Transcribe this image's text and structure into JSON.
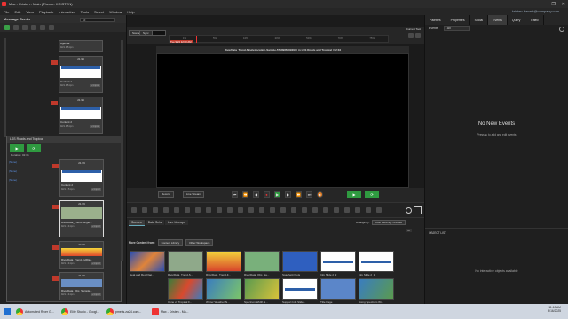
{
  "window": {
    "title": "Max - Kristen - Main (Theme: KRISTEN)",
    "controls": [
      "—",
      "❐",
      "✕"
    ]
  },
  "menu": {
    "items": [
      "File",
      "Edit",
      "View",
      "Playback",
      "Interactive",
      "Tools",
      "Select",
      "Window",
      "Help"
    ],
    "user": "kristen.barrett@company.com"
  },
  "message_center": {
    "title": "Message Center",
    "filter": "All",
    "items": [
      {
        "name": "Agenda",
        "meta": "9/21 4:51pm",
        "badge": ""
      },
      {
        "name": "Content 1",
        "meta": "9/21 4:51pm",
        "badge": "21.99",
        "btn": "+ Import"
      },
      {
        "name": "Content 2",
        "meta": "9/21 4:51pm",
        "badge": "21.99",
        "btn": "+ Import"
      }
    ],
    "rundown_title": "LSS Roads and Tropical",
    "duration_label": "Duration: ",
    "duration": "02:35",
    "rundown_links": [
      "(None)",
      "(None)",
      "(None)"
    ],
    "rundown_items": [
      {
        "name": "Content 2",
        "meta": "9/21 4:51pm",
        "badge": "21.99",
        "btn": "+ Import"
      },
      {
        "name": "RiverData_Trend-Single...",
        "meta": "9/21 4:41pm",
        "badge": "21.99",
        "btn": "+ Import"
      },
      {
        "name": "RiverData_Trend-FullDa...",
        "meta": "9/21 4:41pm",
        "badge": "24.99",
        "btn": "+ Import"
      },
      {
        "name": "RiverData_Obs_Sample...",
        "meta": "9/21 4:41pm",
        "badge": "21.99",
        "btn": "+ Import"
      },
      {
        "name": "RiverData_Forecast",
        "meta": "9/21 4:41pm",
        "badge": "24.99",
        "btn": "+ Import"
      }
    ]
  },
  "timeline": {
    "mode": "Scene",
    "sync_label": "Sync",
    "marker": "Tue 9/24 12:00 AM",
    "end_marker": "Current Tool",
    "marks": [
      "1%",
      "5%",
      "10%",
      "20%",
      "50%",
      "70%",
      "75%"
    ]
  },
  "preview": {
    "caption": "RiverData_Trend-SingleLocation-Sample-5710986669294 | in LSS Roads and Tropical | 02:34"
  },
  "transport": {
    "record": "Record",
    "live_stream": "Live Stream"
  },
  "browser": {
    "tabs": [
      "Scenes",
      "Data Sets",
      "Live Lineups"
    ],
    "arrange_label": "Arrange by:",
    "arrange_value": "Most Recently Created",
    "count": "47",
    "more_content": "More Content from:",
    "sources": [
      "Content Library",
      "Other Workspace"
    ],
    "scenes": [
      {
        "label": "Heat and Red Flag..."
      },
      {
        "label": "RiverData_Trend-S..."
      },
      {
        "label": "RiverData_Trend-F..."
      },
      {
        "label": "RiverData_Obs_Sa..."
      },
      {
        "label": "Spaghetti Plots"
      },
      {
        "label": "Info Slide 2_2"
      },
      {
        "label": "Info Slide 2_1"
      },
      {
        "label": "Cone vs Tropical F..."
      },
      {
        "label": "Winter Weather Al..."
      },
      {
        "label": "Spectrum Width S..."
      },
      {
        "label": "Support Info Slide..."
      },
      {
        "label": "Title Page"
      },
      {
        "label": "Using Spectrum Wi..."
      }
    ]
  },
  "right": {
    "tabs": [
      "Palettes",
      "Properties",
      "Social",
      "Events",
      "Query",
      "Traffic"
    ],
    "events_label": "Events",
    "events_filter": "All",
    "no_events_title": "No New Events",
    "no_events_hint": "Press ⊕ to add and edit events",
    "object_list_title": "OBJECT LIST",
    "no_objects": "No interactive objects available"
  },
  "taskbar": {
    "apps": [
      "Automated River G...",
      "Elite Studio - Googl...",
      "pmelts.za24.com...",
      "Max - Kristen - Ma..."
    ],
    "clock_time": "11:10 AM",
    "clock_date": "9/16/2025"
  },
  "colors": {
    "accent_green": "#2f9a40",
    "record_red": "#c0392b",
    "link_blue": "#5b8ede"
  }
}
